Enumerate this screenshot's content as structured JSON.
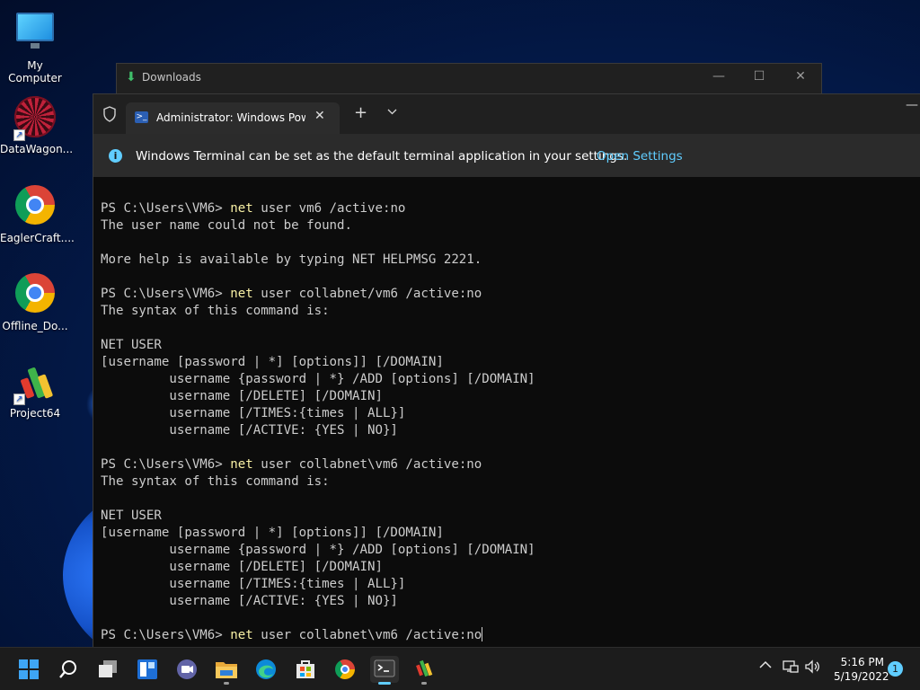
{
  "desktop": {
    "icons": [
      {
        "label": "My Computer"
      },
      {
        "label": "DataWagon..."
      },
      {
        "label": "EaglerCraft...."
      },
      {
        "label": "Offline_Do..."
      },
      {
        "label": "Project64"
      }
    ]
  },
  "downloads_window": {
    "title": "Downloads",
    "minimize": "—",
    "maximize": "☐",
    "close": "✕"
  },
  "terminal": {
    "tab_title": "Administrator: Windows PowerShell",
    "tab_close": "✕",
    "new_tab": "+",
    "dropdown": "⌄",
    "window_minimize": "—",
    "info": {
      "icon": "i",
      "message": "Windows Terminal can be set as the default terminal application in your settings.",
      "link": "Open Settings"
    },
    "lines": [
      {
        "prompt": "PS C:\\Users\\VM6> ",
        "cmd": "net",
        "rest": " user vm6 /active:no"
      },
      {
        "text": "The user name could not be found."
      },
      {
        "text": ""
      },
      {
        "text": "More help is available by typing NET HELPMSG 2221."
      },
      {
        "text": ""
      },
      {
        "prompt": "PS C:\\Users\\VM6> ",
        "cmd": "net",
        "rest": " user collabnet/vm6 /active:no"
      },
      {
        "text": "The syntax of this command is:"
      },
      {
        "text": ""
      },
      {
        "text": "NET USER"
      },
      {
        "text": "[username [password | *] [options]] [/DOMAIN]"
      },
      {
        "text": "         username {password | *} /ADD [options] [/DOMAIN]"
      },
      {
        "text": "         username [/DELETE] [/DOMAIN]"
      },
      {
        "text": "         username [/TIMES:{times | ALL}]"
      },
      {
        "text": "         username [/ACTIVE: {YES | NO}]"
      },
      {
        "text": ""
      },
      {
        "prompt": "PS C:\\Users\\VM6> ",
        "cmd": "net",
        "rest": " user collabnet\\vm6 /active:no"
      },
      {
        "text": "The syntax of this command is:"
      },
      {
        "text": ""
      },
      {
        "text": "NET USER"
      },
      {
        "text": "[username [password | *] [options]] [/DOMAIN]"
      },
      {
        "text": "         username {password | *} /ADD [options] [/DOMAIN]"
      },
      {
        "text": "         username [/DELETE] [/DOMAIN]"
      },
      {
        "text": "         username [/TIMES:{times | ALL}]"
      },
      {
        "text": "         username [/ACTIVE: {YES | NO}]"
      },
      {
        "text": ""
      },
      {
        "prompt": "PS C:\\Users\\VM6> ",
        "cmd": "net",
        "rest": " user collabnet\\vm6 /active:no",
        "cursor": true
      }
    ]
  },
  "taskbar": {
    "apps": [
      {
        "name": "start-icon",
        "running": false
      },
      {
        "name": "search-icon",
        "running": false
      },
      {
        "name": "task-view-icon",
        "running": false
      },
      {
        "name": "widgets-icon",
        "running": false
      },
      {
        "name": "teams-chat-icon",
        "running": false
      },
      {
        "name": "file-explorer-icon",
        "running": true
      },
      {
        "name": "edge-icon",
        "running": false
      },
      {
        "name": "store-icon",
        "running": false
      },
      {
        "name": "chrome-icon",
        "running": false
      },
      {
        "name": "terminal-icon",
        "running": true,
        "active": true
      },
      {
        "name": "project64-icon",
        "running": true
      }
    ],
    "tray": {
      "chevron": "^",
      "time": "5:16 PM",
      "date": "5/19/2022",
      "notifications": "1"
    }
  },
  "colors": {
    "command": "#f9f1a5",
    "console_text": "#cccccc",
    "accent": "#60cdff"
  }
}
